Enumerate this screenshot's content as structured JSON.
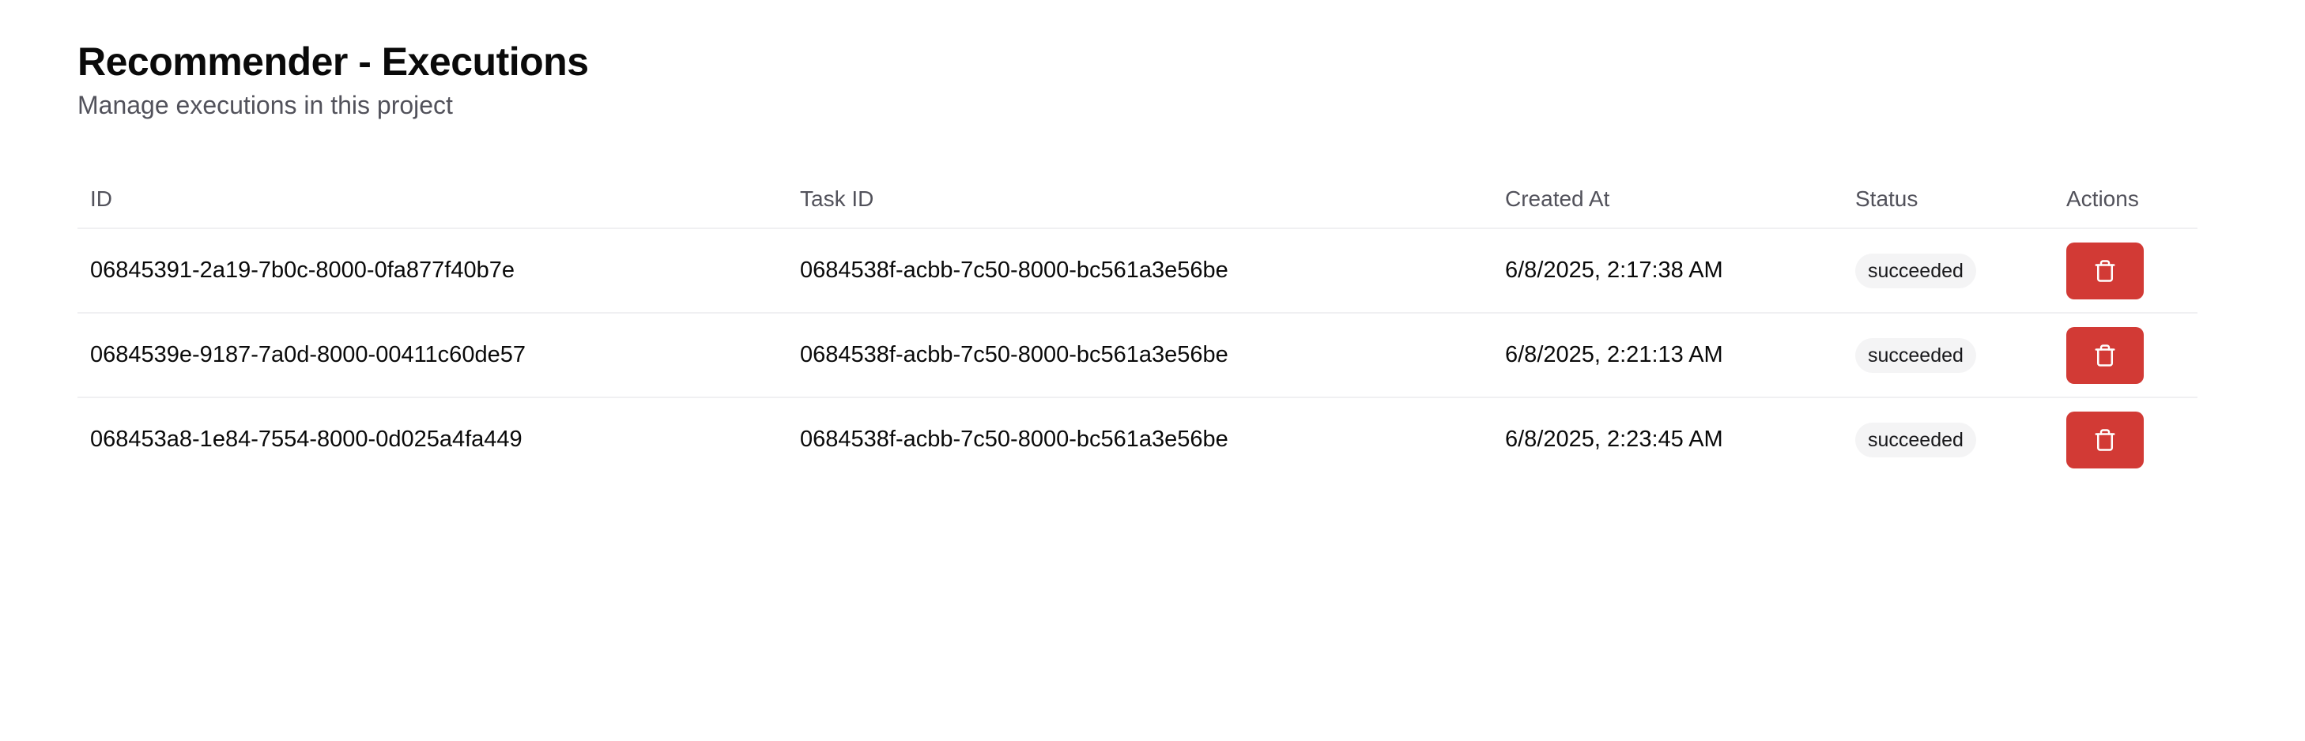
{
  "header": {
    "title": "Recommender - Executions",
    "subtitle": "Manage executions in this project"
  },
  "table": {
    "columns": [
      "ID",
      "Task ID",
      "Created At",
      "Status",
      "Actions"
    ],
    "rows": [
      {
        "id": "06845391-2a19-7b0c-8000-0fa877f40b7e",
        "task_id": "0684538f-acbb-7c50-8000-bc561a3e56be",
        "created_at": "6/8/2025, 2:17:38 AM",
        "status": "succeeded"
      },
      {
        "id": "0684539e-9187-7a0d-8000-00411c60de57",
        "task_id": "0684538f-acbb-7c50-8000-bc561a3e56be",
        "created_at": "6/8/2025, 2:21:13 AM",
        "status": "succeeded"
      },
      {
        "id": "068453a8-1e84-7554-8000-0d025a4fa449",
        "task_id": "0684538f-acbb-7c50-8000-bc561a3e56be",
        "created_at": "6/8/2025, 2:23:45 AM",
        "status": "succeeded"
      }
    ]
  },
  "icons": {
    "delete": "trash-icon"
  },
  "colors": {
    "delete_button": "#d23a35",
    "badge_bg": "#f4f4f5",
    "muted_text": "#52525b"
  }
}
